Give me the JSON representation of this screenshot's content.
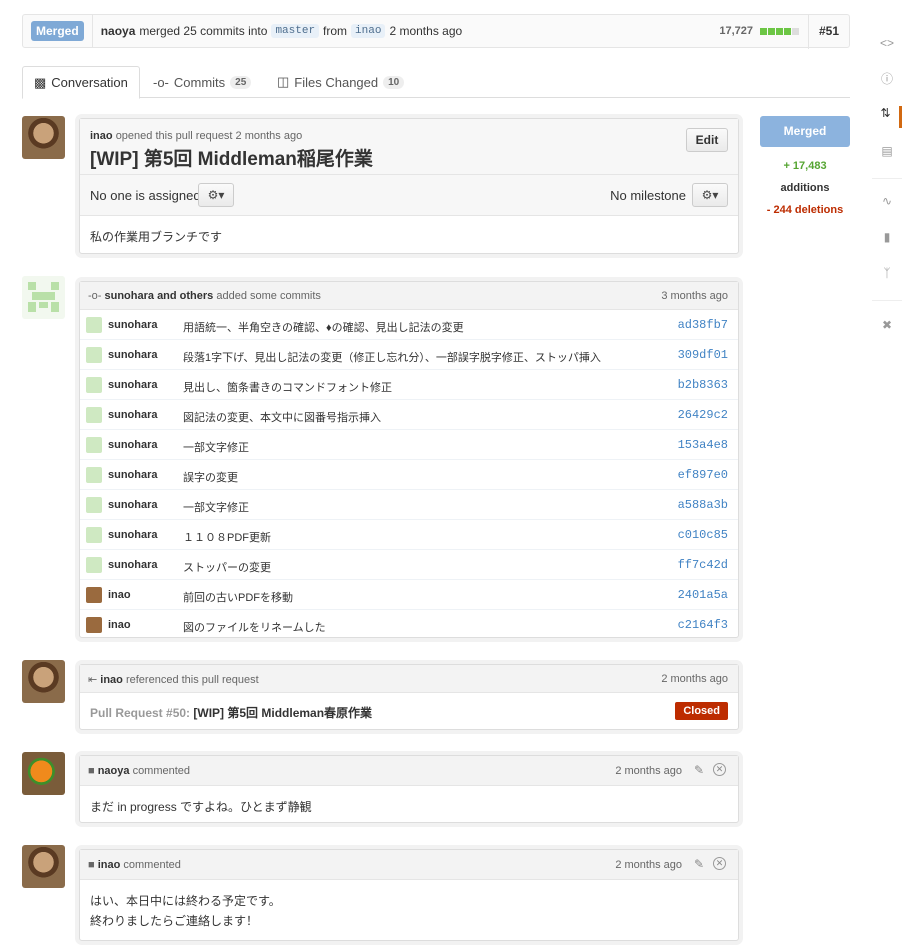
{
  "topbar": {
    "state": "Merged",
    "author": "naoya",
    "action": "merged 25 commits into",
    "base": "master",
    "from_word": "from",
    "head": "inao",
    "time": "2 months ago",
    "additions_total": "17,727",
    "diffstat_fraction": 0.9,
    "number": "#51"
  },
  "tabs": [
    {
      "label": "Conversation",
      "count": ""
    },
    {
      "label": "Commits",
      "count": "25"
    },
    {
      "label": "Files Changed",
      "count": "10"
    }
  ],
  "opening": {
    "author": "inao",
    "meta": "opened this pull request 2 months ago",
    "title": "[WIP] 第5回 Middleman稲尾作業",
    "edit_label": "Edit",
    "assignee": "No one is assigned",
    "milestone": "No milestone",
    "body": "私の作業用ブランチです"
  },
  "sidebar": {
    "state": "Merged",
    "additions_value": "+ 17,483",
    "additions_label": "additions",
    "deletions": "- 244 deletions"
  },
  "commits": {
    "header_authors": "sunohara and others",
    "header_action": "added some commits",
    "header_time": "3 months ago",
    "rows": [
      {
        "author": "sunohara",
        "message": "用語統一、半角空きの確認、♦の確認、見出し記法の変更",
        "sha": "ad38fb7"
      },
      {
        "author": "sunohara",
        "message": "段落1字下げ、見出し記法の変更（修正し忘れ分）、一部誤字脱字修正、ストッパ挿入",
        "sha": "309df01"
      },
      {
        "author": "sunohara",
        "message": "見出し、箇条書きのコマンドフォント修正",
        "sha": "b2b8363"
      },
      {
        "author": "sunohara",
        "message": "図記法の変更、本文中に図番号指示挿入",
        "sha": "26429c2"
      },
      {
        "author": "sunohara",
        "message": "一部文字修正",
        "sha": "153a4e8"
      },
      {
        "author": "sunohara",
        "message": "誤字の変更",
        "sha": "ef897e0"
      },
      {
        "author": "sunohara",
        "message": "一部文字修正",
        "sha": "a588a3b"
      },
      {
        "author": "sunohara",
        "message": "１１０８PDF更新",
        "sha": "c010c85"
      },
      {
        "author": "sunohara",
        "message": "ストッパーの変更",
        "sha": "ff7c42d"
      },
      {
        "author": "inao",
        "message": "前回の古いPDFを移動",
        "sha": "2401a5a"
      },
      {
        "author": "inao",
        "message": "図のファイルをリネームした",
        "sha": "c2164f3"
      }
    ]
  },
  "reference": {
    "author": "inao",
    "action": "referenced this pull request",
    "time": "2 months ago",
    "pr_label": "Pull Request #50:",
    "pr_title": "[WIP] 第5回 Middleman春原作業",
    "status": "Closed"
  },
  "comments": [
    {
      "author": "naoya",
      "action": "commented",
      "time": "2 months ago",
      "lines": [
        "まだ in progress ですよね。ひとまず静観"
      ]
    },
    {
      "author": "inao",
      "action": "commented",
      "time": "2 months ago",
      "lines": [
        "はい、本日中には終わる予定です。",
        "終わりましたらご連絡します！"
      ]
    }
  ],
  "rail_icons": [
    "code-icon",
    "issues-icon",
    "pull-request-icon",
    "wiki-icon",
    "pulse-icon",
    "graphs-icon",
    "network-icon",
    "settings-icon"
  ],
  "colors": {
    "merged": "#8cb3de",
    "closed": "#bd2c00",
    "sha_link": "#4183c4",
    "additions": "#55a532",
    "deletions": "#bd2c00"
  }
}
